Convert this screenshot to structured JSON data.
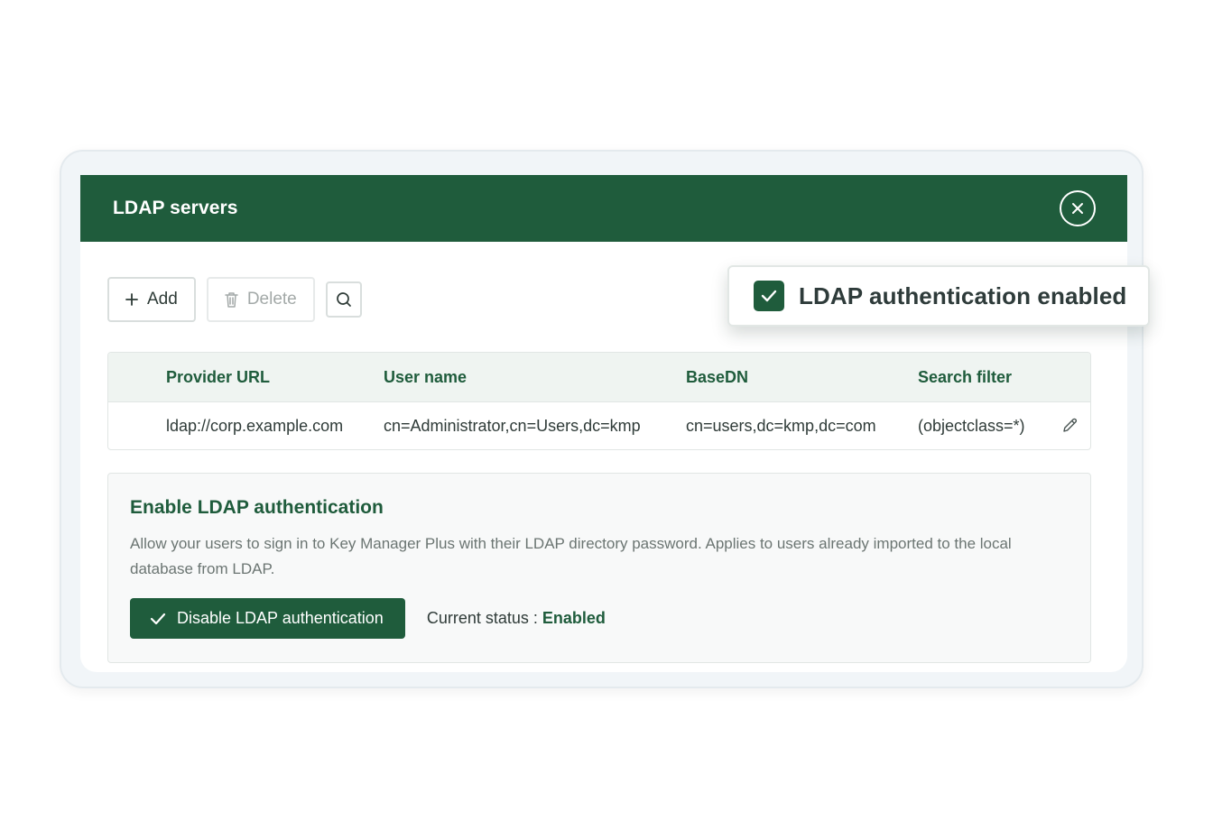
{
  "window": {
    "title": "LDAP servers"
  },
  "toolbar": {
    "add_label": "Add",
    "delete_label": "Delete"
  },
  "table": {
    "columns": [
      "Provider URL",
      "User name",
      "BaseDN",
      "Search filter"
    ],
    "rows": [
      {
        "provider_url": "ldap://corp.example.com",
        "user_name": "cn=Administrator,cn=Users,dc=kmp",
        "base_dn": "cn=users,dc=kmp,dc=com",
        "search_filter": "(objectclass=*)"
      }
    ]
  },
  "auth_section": {
    "title": "Enable LDAP authentication",
    "description": "Allow your users to sign in to Key Manager Plus with their LDAP directory password. Applies to users already imported to the local database from LDAP.",
    "button_label": "Disable LDAP authentication",
    "status_label": "Current status : ",
    "status_value": "Enabled"
  },
  "toast": {
    "message": "LDAP authentication enabled"
  },
  "colors": {
    "brand_green": "#1f5c3c",
    "header_bg": "#1f5c3c",
    "table_header_bg": "#eff4f1"
  },
  "icons": [
    "close-icon",
    "plus-icon",
    "trash-icon",
    "search-icon",
    "pencil-icon",
    "check-icon",
    "checkbox-checked-icon"
  ]
}
